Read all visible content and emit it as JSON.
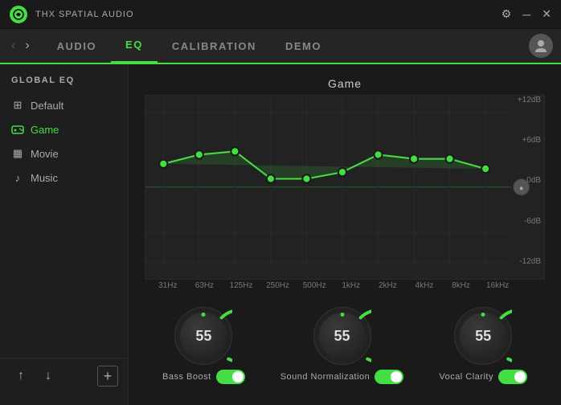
{
  "titleBar": {
    "appName": "THX SPATIAL AUDIO",
    "controls": [
      "⚙",
      "─",
      "✕"
    ]
  },
  "nav": {
    "items": [
      {
        "label": "AUDIO",
        "active": false
      },
      {
        "label": "EQ",
        "active": true
      },
      {
        "label": "CALIBRATION",
        "active": false
      },
      {
        "label": "DEMO",
        "active": false
      }
    ]
  },
  "sidebar": {
    "title": "GLOBAL EQ",
    "items": [
      {
        "label": "Default",
        "icon": "⊞",
        "active": false
      },
      {
        "label": "Game",
        "icon": "🎮",
        "active": true
      },
      {
        "label": "Movie",
        "icon": "▦",
        "active": false
      },
      {
        "label": "Music",
        "icon": "♪",
        "active": false
      }
    ],
    "upBtn": "↑",
    "downBtn": "↓",
    "addBtn": "+"
  },
  "eq": {
    "title": "Game",
    "yLabels": [
      "+12dB",
      "+6dB",
      "0dB",
      "-6dB",
      "-12dB"
    ],
    "xLabels": [
      "31Hz",
      "63Hz",
      "125Hz",
      "250Hz",
      "500Hz",
      "1kHz",
      "2kHz",
      "4kHz",
      "8kHz",
      "16kHz"
    ],
    "points": [
      {
        "freq": "31Hz",
        "value": 3
      },
      {
        "freq": "63Hz",
        "value": 4.5
      },
      {
        "freq": "125Hz",
        "value": 5
      },
      {
        "freq": "250Hz",
        "value": 1
      },
      {
        "freq": "500Hz",
        "value": 1
      },
      {
        "freq": "1kHz",
        "value": 2
      },
      {
        "freq": "2kHz",
        "value": 4
      },
      {
        "freq": "4kHz",
        "value": 3.5
      },
      {
        "freq": "8kHz",
        "value": 3.5
      },
      {
        "freq": "16kHz",
        "value": 2
      }
    ]
  },
  "knobs": [
    {
      "label": "Bass Boost",
      "value": "55",
      "enabled": true
    },
    {
      "label": "Sound Normalization",
      "value": "55",
      "enabled": true
    },
    {
      "label": "Vocal Clarity",
      "value": "55",
      "enabled": true
    }
  ],
  "colors": {
    "accent": "#44dd44",
    "bg": "#1a1a1a",
    "sidebar": "#1e1e1e"
  }
}
